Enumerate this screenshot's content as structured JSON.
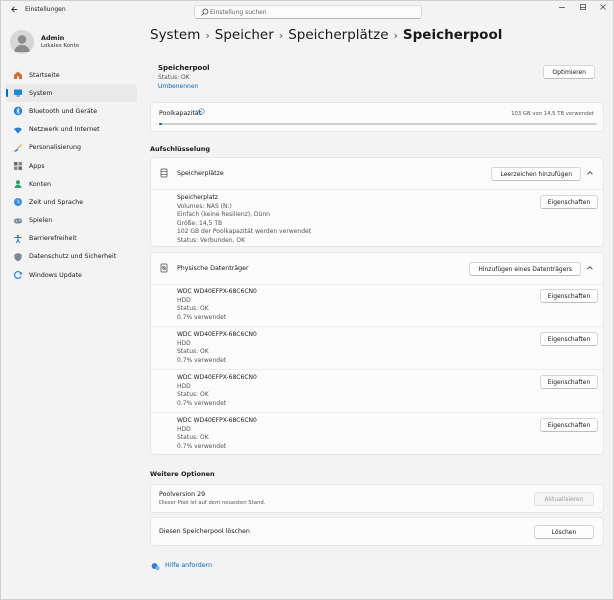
{
  "window": {
    "title": "Einstellungen",
    "controls": [
      "minimize",
      "maximize",
      "close"
    ]
  },
  "search": {
    "placeholder": "Einstellung suchen"
  },
  "profile": {
    "name": "Admin",
    "account": "Lokales Konto"
  },
  "sidebar": {
    "items": [
      {
        "label": "Startseite",
        "icon": "home-icon"
      },
      {
        "label": "System",
        "icon": "monitor-icon",
        "active": true
      },
      {
        "label": "Bluetooth und Geräte",
        "icon": "bluetooth-icon"
      },
      {
        "label": "Netzwerk und Internet",
        "icon": "wifi-icon"
      },
      {
        "label": "Personalisierung",
        "icon": "brush-icon"
      },
      {
        "label": "Apps",
        "icon": "apps-icon"
      },
      {
        "label": "Konten",
        "icon": "person-icon"
      },
      {
        "label": "Zeit und Sprache",
        "icon": "globe-clock-icon"
      },
      {
        "label": "Spielen",
        "icon": "gamepad-icon"
      },
      {
        "label": "Barrierefreiheit",
        "icon": "accessibility-icon"
      },
      {
        "label": "Datenschutz und Sicherheit",
        "icon": "shield-icon"
      },
      {
        "label": "Windows Update",
        "icon": "update-icon"
      }
    ]
  },
  "breadcrumb": [
    "System",
    "Speicher",
    "Speicherplätze",
    "Speicherpool"
  ],
  "pool": {
    "title": "Speicherpool",
    "status": "Status: OK",
    "rename": "Umbenennen",
    "optimize": "Optimieren"
  },
  "capacity": {
    "label": "Poolkapazität",
    "value": "103 GB von 14,5 TB verwendet",
    "used_fraction": 0.007
  },
  "breakdown": {
    "title": "Aufschlüsselung",
    "spaces": {
      "label": "Speicherplätze",
      "add_button": "Leerzeichen hinzufügen",
      "items": [
        {
          "lines": [
            "Speicherplatz",
            "Volumes: NAS (N:)",
            "Einfach (keine Resilienz), Dünn",
            "Größe: 14,5 TB",
            "102 GB der Poolkapazität werden verwendet",
            "Status: Verbunden, OK"
          ],
          "button": "Eigenschaften"
        }
      ]
    },
    "disks": {
      "label": "Physische Datenträger",
      "add_button": "Hinzufügen eines Datenträgers",
      "items": [
        {
          "lines": [
            "WDC WD40EFPX-68C6CN0",
            "HDD",
            "Status: OK",
            "0.7% verwendet"
          ],
          "button": "Eigenschaften"
        },
        {
          "lines": [
            "WDC WD40EFPX-68C6CN0",
            "HDD",
            "Status: OK",
            "0.7% verwendet"
          ],
          "button": "Eigenschaften"
        },
        {
          "lines": [
            "WDC WD40EFPX-68C6CN0",
            "HDD",
            "Status: OK",
            "0.7% verwendet"
          ],
          "button": "Eigenschaften"
        },
        {
          "lines": [
            "WDC WD40EFPX-68C6CN0",
            "HDD",
            "Status: OK",
            "0.7% verwendet"
          ],
          "button": "Eigenschaften"
        }
      ]
    }
  },
  "more_options": {
    "title": "Weitere Optionen",
    "version": {
      "label": "Poolversion 29",
      "sub": "Dieser Pool ist auf dem neuesten Stand.",
      "button": "Aktualisieren"
    },
    "delete": {
      "label": "Diesen Speicherpool löschen",
      "button": "Löschen"
    }
  },
  "help": {
    "label": "Hilfe anfordern"
  },
  "colors": {
    "accent": "#0067c0",
    "background": "#f3f3f3",
    "card": "#fbfbfb"
  }
}
